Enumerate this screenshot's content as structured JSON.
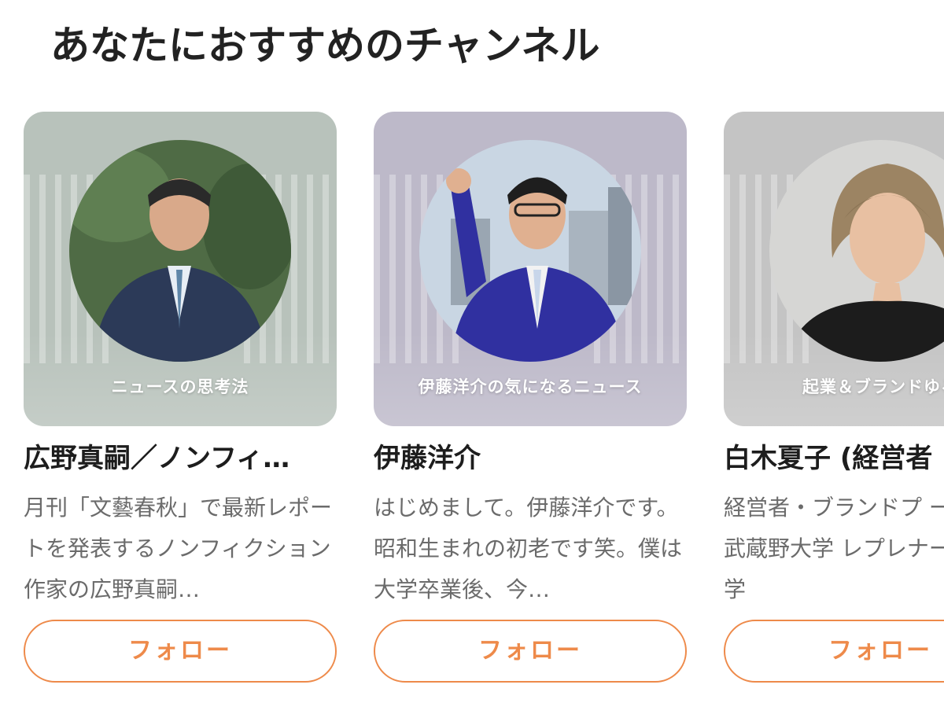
{
  "section": {
    "title": "あなたにおすすめのチャンネル"
  },
  "channels": [
    {
      "cover_label": "ニュースの思考法",
      "name": "広野真嗣／ノンフィ…",
      "description": "月刊「文藝春秋」で最新レポートを発表するノンフィクション作家の広野真嗣…",
      "follow_label": "フォロー",
      "cover_color": "#b8c2bb",
      "avatar_bg": "#4f6b45",
      "suit_color": "#2c3a58"
    },
    {
      "cover_label": "伊藤洋介の気になるニュース",
      "name": "伊藤洋介",
      "description": "はじめまして。伊藤洋介です。昭和生まれの初老です笑。僕は大学卒業後、今…",
      "follow_label": "フォロー",
      "cover_color": "#bdb9c9",
      "avatar_bg": "#9fb0c2",
      "suit_color": "#3030a0"
    },
    {
      "cover_label": "起業＆ブランドゆる",
      "name": "白木夏子 (経営者",
      "description": "経営者・ブランドプ ーサー・武蔵野大学 レプレナーシップ学",
      "follow_label": "フォロー",
      "cover_color": "#c4c4c4",
      "avatar_bg": "#d6d6d4",
      "suit_color": "#1c1c1c"
    }
  ],
  "colors": {
    "accent": "#ee8a4a",
    "title_text": "#222222",
    "description_text": "#6b6b6b"
  },
  "icons": {
    "avatar": "person-photo"
  }
}
